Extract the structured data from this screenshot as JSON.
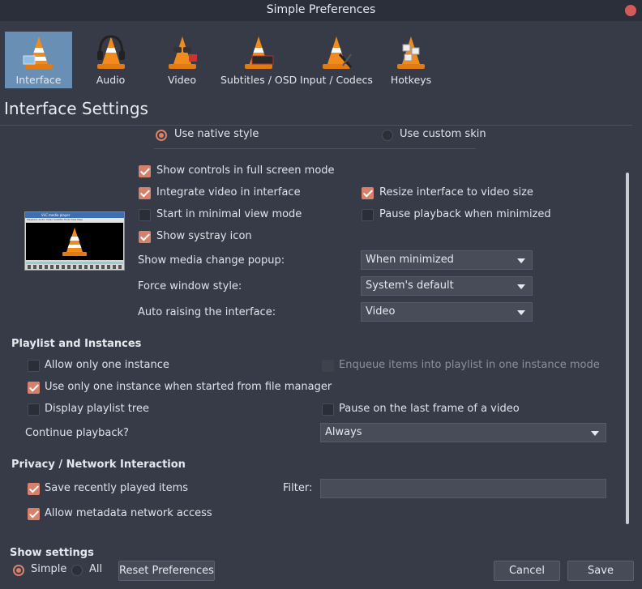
{
  "window": {
    "title": "Simple Preferences"
  },
  "tabs": [
    {
      "label": "Interface",
      "icon": "interface-cone-icon",
      "active": true
    },
    {
      "label": "Audio",
      "icon": "audio-headphones-cone-icon",
      "active": false
    },
    {
      "label": "Video",
      "icon": "video-glasses-cone-icon",
      "active": false
    },
    {
      "label": "Subtitles / OSD",
      "icon": "subtitles-cone-icon",
      "active": false
    },
    {
      "label": "Input / Codecs",
      "icon": "input-codecs-cone-icon",
      "active": false
    },
    {
      "label": "Hotkeys",
      "icon": "hotkeys-cone-icon",
      "active": false
    }
  ],
  "section_title": "Interface Settings",
  "look": {
    "native_label": "Use native style",
    "native_selected": true,
    "custom_label": "Use custom skin",
    "custom_selected": false
  },
  "interface": {
    "fullscreen_controls": {
      "label": "Show controls in full screen mode",
      "checked": true
    },
    "integrate_video": {
      "label": "Integrate video in interface",
      "checked": true
    },
    "resize_interface": {
      "label": "Resize interface to video size",
      "checked": true
    },
    "minimal_view": {
      "label": "Start in minimal view mode",
      "checked": false
    },
    "pause_minimized": {
      "label": "Pause playback when minimized",
      "checked": false
    },
    "systray": {
      "label": "Show systray icon",
      "checked": true
    },
    "media_popup": {
      "label": "Show media change popup:",
      "value": "When minimized"
    },
    "window_style": {
      "label": "Force window style:",
      "value": "System's default"
    },
    "auto_raise": {
      "label": "Auto raising the interface:",
      "value": "Video"
    }
  },
  "preview": {
    "title": "VLC media player",
    "menu": "Playback Audio Video Subtitle Tools View Help"
  },
  "playlist": {
    "heading": "Playlist and Instances",
    "one_instance": {
      "label": "Allow only one instance",
      "checked": false
    },
    "enqueue": {
      "label": "Enqueue items into playlist in one instance mode",
      "checked": false,
      "disabled": true
    },
    "file_manager": {
      "label": "Use only one instance when started from file manager",
      "checked": true
    },
    "playlist_tree": {
      "label": "Display playlist tree",
      "checked": false
    },
    "pause_last": {
      "label": "Pause on the last frame of a video",
      "checked": false
    },
    "continue": {
      "label": "Continue playback?",
      "value": "Always"
    }
  },
  "privacy": {
    "heading": "Privacy / Network Interaction",
    "recent": {
      "label": "Save recently played items",
      "checked": true
    },
    "filter_label": "Filter:",
    "filter_value": "",
    "metadata": {
      "label": "Allow metadata network access",
      "checked": true
    }
  },
  "footer": {
    "show_settings": "Show settings",
    "simple": "Simple",
    "all": "All",
    "reset": "Reset Preferences",
    "cancel": "Cancel",
    "save": "Save"
  },
  "colors": {
    "accent": "#d7816b",
    "active_tab": "#6a8fb5",
    "background": "#363b47"
  }
}
